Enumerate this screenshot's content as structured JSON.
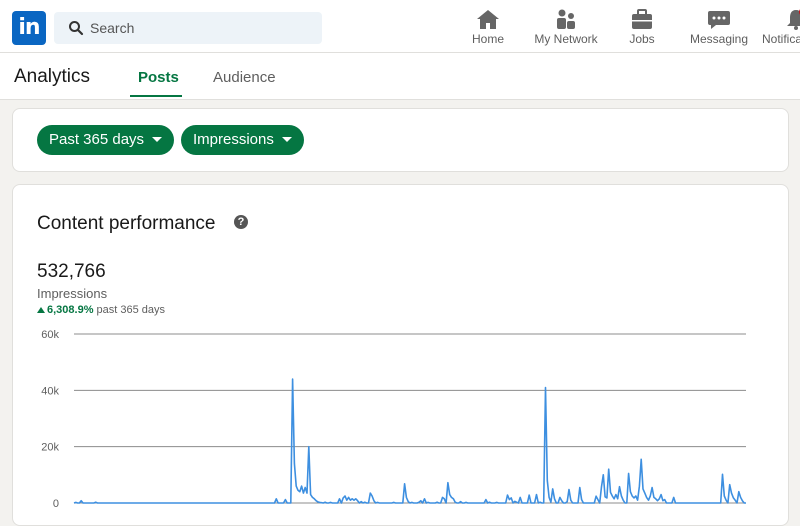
{
  "nav": {
    "logo": "in",
    "search_placeholder": "Search",
    "items": [
      {
        "label": "Home",
        "icon": "home-icon"
      },
      {
        "label": "My Network",
        "icon": "network-icon"
      },
      {
        "label": "Jobs",
        "icon": "briefcase-icon"
      },
      {
        "label": "Messaging",
        "icon": "messaging-icon"
      },
      {
        "label": "Notifications",
        "icon": "bell-icon"
      }
    ]
  },
  "subnav": {
    "title": "Analytics",
    "tabs": [
      {
        "label": "Posts",
        "active": true
      },
      {
        "label": "Audience",
        "active": false
      }
    ]
  },
  "filters": {
    "time_range": "Past 365 days",
    "metric": "Impressions"
  },
  "card": {
    "title": "Content performance",
    "total": "532,766",
    "metric_label": "Impressions",
    "change": "6,308.9%",
    "change_suffix": "past 365 days"
  },
  "colors": {
    "brand": "#0a66c2",
    "accent_green": "#057642",
    "line": "#3d8fe0"
  },
  "chart_data": {
    "type": "line",
    "y_ticks": [
      "60k",
      "40k",
      "20k",
      "0"
    ],
    "ylim": [
      0,
      60000
    ],
    "grid": true,
    "series": [
      {
        "values": [
          0,
          200,
          0,
          0,
          800,
          0,
          0,
          0,
          0,
          0,
          0,
          0,
          300,
          0,
          0,
          0,
          0,
          0,
          0,
          0,
          0,
          0,
          0,
          0,
          0,
          0,
          0,
          0,
          0,
          0,
          0,
          0,
          0,
          0,
          0,
          0,
          0,
          0,
          0,
          0,
          0,
          0,
          0,
          0,
          0,
          0,
          0,
          0,
          0,
          0,
          0,
          0,
          0,
          0,
          0,
          0,
          0,
          0,
          0,
          0,
          0,
          0,
          0,
          0,
          0,
          0,
          0,
          0,
          0,
          0,
          0,
          0,
          0,
          0,
          0,
          0,
          0,
          0,
          0,
          0,
          0,
          0,
          0,
          0,
          0,
          0,
          0,
          0,
          0,
          0,
          0,
          0,
          0,
          0,
          0,
          0,
          0,
          0,
          0,
          0,
          0,
          0,
          0,
          0,
          0,
          0,
          0,
          0,
          0,
          0,
          0,
          0,
          1500,
          0,
          0,
          0,
          0,
          1200,
          0,
          0,
          0,
          44000,
          14000,
          6000,
          4500,
          4000,
          6000,
          3500,
          5500,
          3500,
          20000,
          3000,
          2000,
          1500,
          800,
          400,
          200,
          100,
          0,
          300,
          0,
          0,
          200,
          0,
          0,
          0,
          0,
          1500,
          0,
          1800,
          2500,
          1000,
          2000,
          1000,
          1500,
          1000,
          1500,
          800,
          0,
          500,
          0,
          300,
          0,
          0,
          3500,
          2500,
          800,
          0,
          200,
          0,
          0,
          0,
          0,
          0,
          0,
          0,
          0,
          200,
          0,
          0,
          0,
          0,
          0,
          6800,
          2000,
          500,
          0,
          200,
          0,
          0,
          0,
          300,
          800,
          0,
          1500,
          0,
          200,
          0,
          0,
          0,
          0,
          300,
          0,
          0,
          2000,
          1500,
          0,
          7200,
          3000,
          2000,
          1500,
          300,
          0,
          0,
          500,
          0,
          0,
          200,
          0,
          0,
          0,
          0,
          0,
          0,
          0,
          0,
          0,
          0,
          1200,
          0,
          300,
          0,
          0,
          0,
          200,
          0,
          0,
          0,
          0,
          0,
          2800,
          1200,
          1800,
          0,
          600,
          300,
          0,
          2000,
          0,
          0,
          0,
          0,
          2800,
          0,
          0,
          0,
          3000,
          0,
          300,
          0,
          0,
          41000,
          8000,
          2000,
          300,
          5000,
          1500,
          0,
          0,
          2000,
          800,
          0,
          0,
          500,
          4800,
          1000,
          0,
          0,
          0,
          0,
          5500,
          1200,
          0,
          0,
          0,
          0,
          0,
          0,
          0,
          2400,
          1200,
          0,
          5800,
          10000,
          2200,
          1800,
          12000,
          3800,
          2500,
          1500,
          3000,
          1500,
          5800,
          2500,
          1000,
          0,
          0,
          10500,
          4000,
          2500,
          1800,
          2500,
          1000,
          6000,
          15500,
          5000,
          3500,
          2000,
          1000,
          2500,
          5500,
          2000,
          1500,
          800,
          1500,
          3000,
          800,
          1200,
          0,
          0,
          0,
          0,
          2000,
          0,
          0,
          0,
          0,
          0,
          0,
          0,
          0,
          0,
          0,
          0,
          0,
          0,
          0,
          0,
          0,
          0,
          0,
          0,
          0,
          0,
          0,
          0,
          0,
          0,
          0,
          10200,
          2500,
          1000,
          0,
          6500,
          3500,
          1800,
          1000,
          0,
          4000,
          2000,
          800,
          0,
          0
        ]
      }
    ]
  }
}
